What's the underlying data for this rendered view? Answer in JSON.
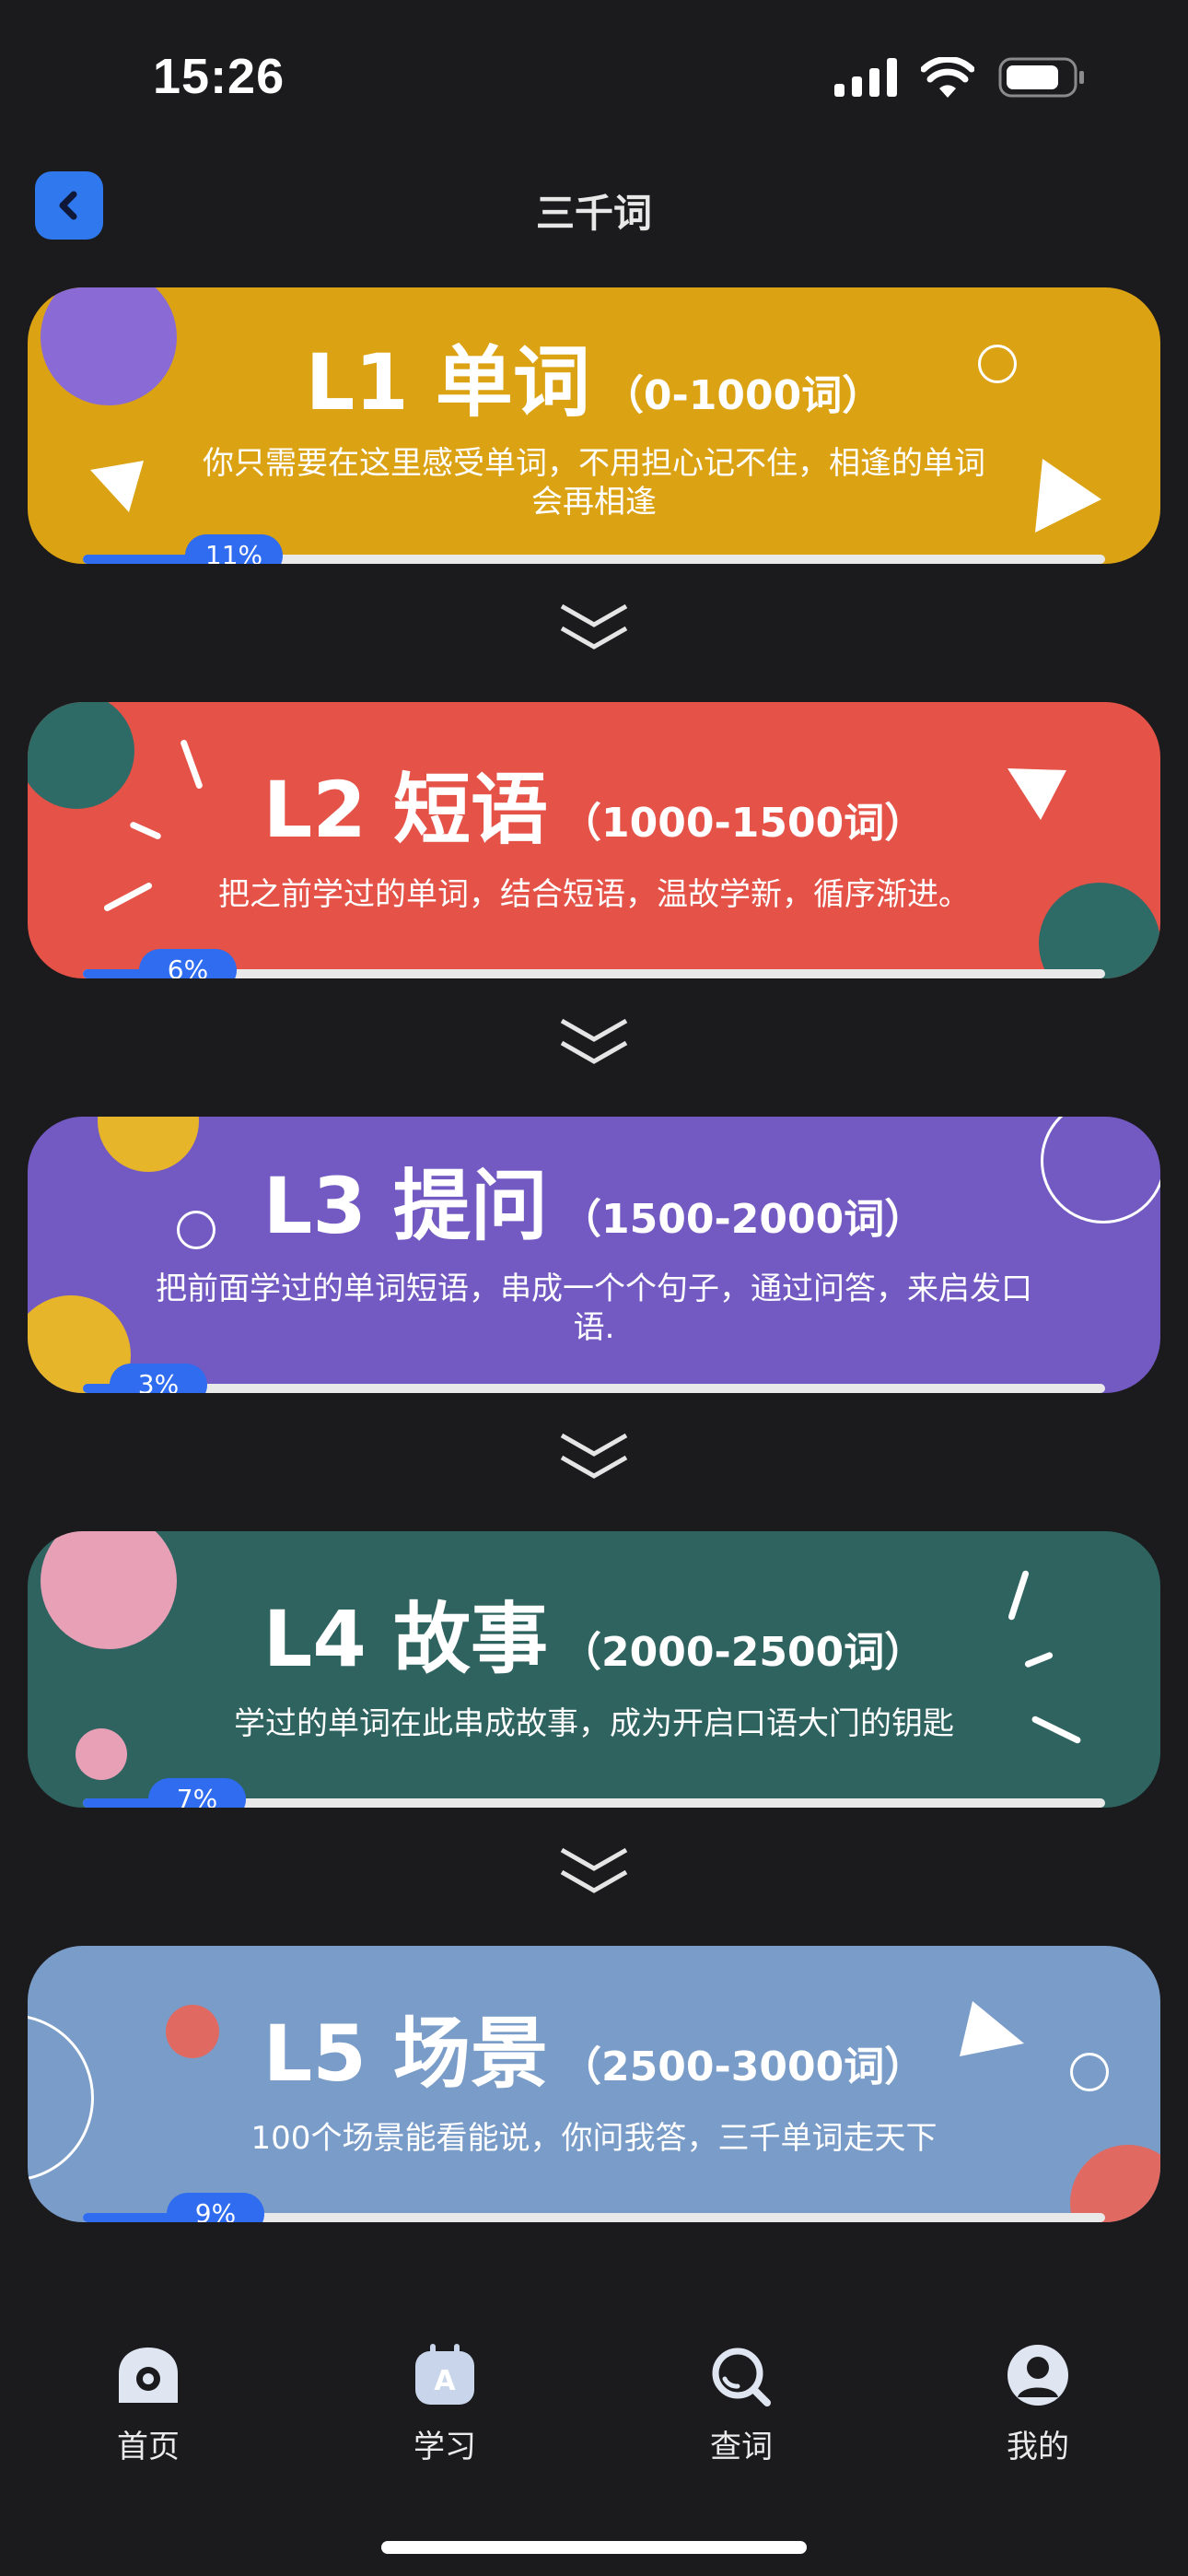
{
  "status": {
    "time": "15:26"
  },
  "header": {
    "title": "三千词"
  },
  "levels": [
    {
      "title": "L1 单词",
      "range": "（0-1000词）",
      "desc": "你只需要在这里感受单词，不用担心记不住，相逢的单词会再相逢",
      "progress": "11%",
      "progress_value": 0.11,
      "color": "#dba214"
    },
    {
      "title": "L2 短语",
      "range": "（1000-1500词）",
      "desc": "把之前学过的单词，结合短语，温故学新，循序渐进。",
      "progress": "6%",
      "progress_value": 0.06,
      "color": "#e45248"
    },
    {
      "title": "L3 提问",
      "range": "（1500-2000词）",
      "desc": "把前面学过的单词短语，串成一个个句子，通过问答，来启发口语.",
      "progress": "3%",
      "progress_value": 0.03,
      "color": "#735ac2"
    },
    {
      "title": "L4 故事",
      "range": "（2000-2500词）",
      "desc": "学过的单词在此串成故事，成为开启口语大门的钥匙",
      "progress": "7%",
      "progress_value": 0.07,
      "color": "#2f6360"
    },
    {
      "title": "L5 场景",
      "range": "（2500-3000词）",
      "desc": "100个场景能看能说，你问我答，三千单词走天下",
      "progress": "9%",
      "progress_value": 0.09,
      "color": "#7a9cc8"
    }
  ],
  "tabs": [
    {
      "label": "首页",
      "icon": "home-icon"
    },
    {
      "label": "学习",
      "icon": "study-icon"
    },
    {
      "label": "查词",
      "icon": "search-icon"
    },
    {
      "label": "我的",
      "icon": "profile-icon"
    }
  ]
}
